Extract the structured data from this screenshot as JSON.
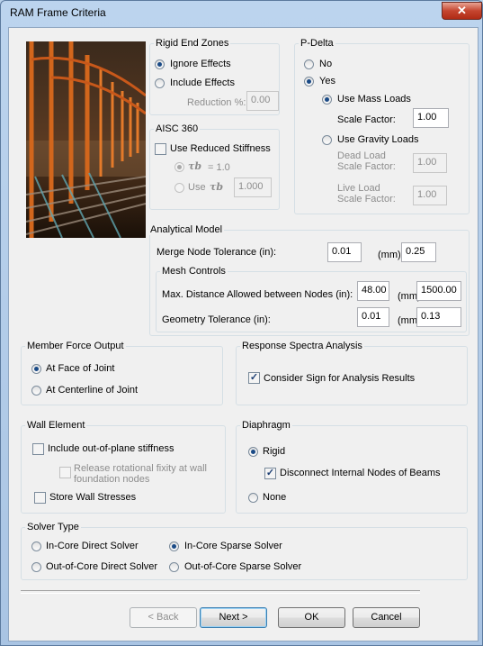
{
  "window": {
    "title": "RAM Frame Criteria",
    "close": "✕"
  },
  "rigid_end_zones": {
    "title": "Rigid End Zones",
    "ignore_effects": "Ignore Effects",
    "include_effects": "Include Effects",
    "reduction_label": "Reduction %:",
    "reduction_value": "0.00",
    "selected": "ignore_effects"
  },
  "aisc360": {
    "title": "AISC 360",
    "use_reduced_stiffness": "Use Reduced Stiffness",
    "tau_eq": "= 1.0",
    "use_label": "Use",
    "use_value": "1.000"
  },
  "p_delta": {
    "title": "P-Delta",
    "no": "No",
    "yes": "Yes",
    "selected": "yes",
    "use_mass_loads": "Use Mass Loads",
    "scale_factor_label": "Scale Factor:",
    "scale_factor_value": "1.00",
    "use_gravity_loads": "Use Gravity Loads",
    "dead_load_label": "Dead Load",
    "dead_scale_label": "Scale Factor:",
    "dead_value": "1.00",
    "live_load_label": "Live Load",
    "live_scale_label": "Scale Factor:",
    "live_value": "1.00"
  },
  "analytical_model": {
    "title": "Analytical Model",
    "merge_label": "Merge Node Tolerance (in):",
    "merge_in": "0.01",
    "merge_unit": "(mm)",
    "merge_mm": "0.25",
    "mesh_title": "Mesh Controls",
    "max_dist_label": "Max. Distance Allowed between Nodes (in):",
    "max_dist_in": "48.00",
    "max_dist_unit": "(mm)",
    "max_dist_mm": "1500.00",
    "geom_label": "Geometry Tolerance (in):",
    "geom_in": "0.01",
    "geom_unit": "(mm)",
    "geom_mm": "0.13"
  },
  "member_force": {
    "title": "Member Force Output",
    "face": "At Face of Joint",
    "centerline": "At Centerline of Joint",
    "selected": "face"
  },
  "response_spectra": {
    "title": "Response Spectra Analysis",
    "consider_sign": "Consider Sign for Analysis Results",
    "consider_sign_checked": true
  },
  "wall_element": {
    "title": "Wall Element",
    "include_oop": "Include out-of-plane stiffness",
    "release_line1": "Release rotational fixity at wall",
    "release_line2": "foundation nodes",
    "store_stresses": "Store Wall Stresses"
  },
  "diaphragm": {
    "title": "Diaphragm",
    "rigid": "Rigid",
    "disconnect": "Disconnect Internal Nodes of Beams",
    "disconnect_checked": true,
    "none": "None",
    "selected": "rigid"
  },
  "solver": {
    "title": "Solver Type",
    "in_core_direct": "In-Core Direct Solver",
    "in_core_sparse": "In-Core Sparse Solver",
    "out_core_direct": "Out-of-Core Direct Solver",
    "out_core_sparse": "Out-of-Core Sparse Solver",
    "selected": "in_core_sparse"
  },
  "buttons": {
    "back": "< Back",
    "next": "Next >",
    "ok": "OK",
    "cancel": "Cancel"
  },
  "colors": {
    "accent": "#1a4a86",
    "photo_beam": "#d2661c",
    "close": "#c5452f"
  }
}
